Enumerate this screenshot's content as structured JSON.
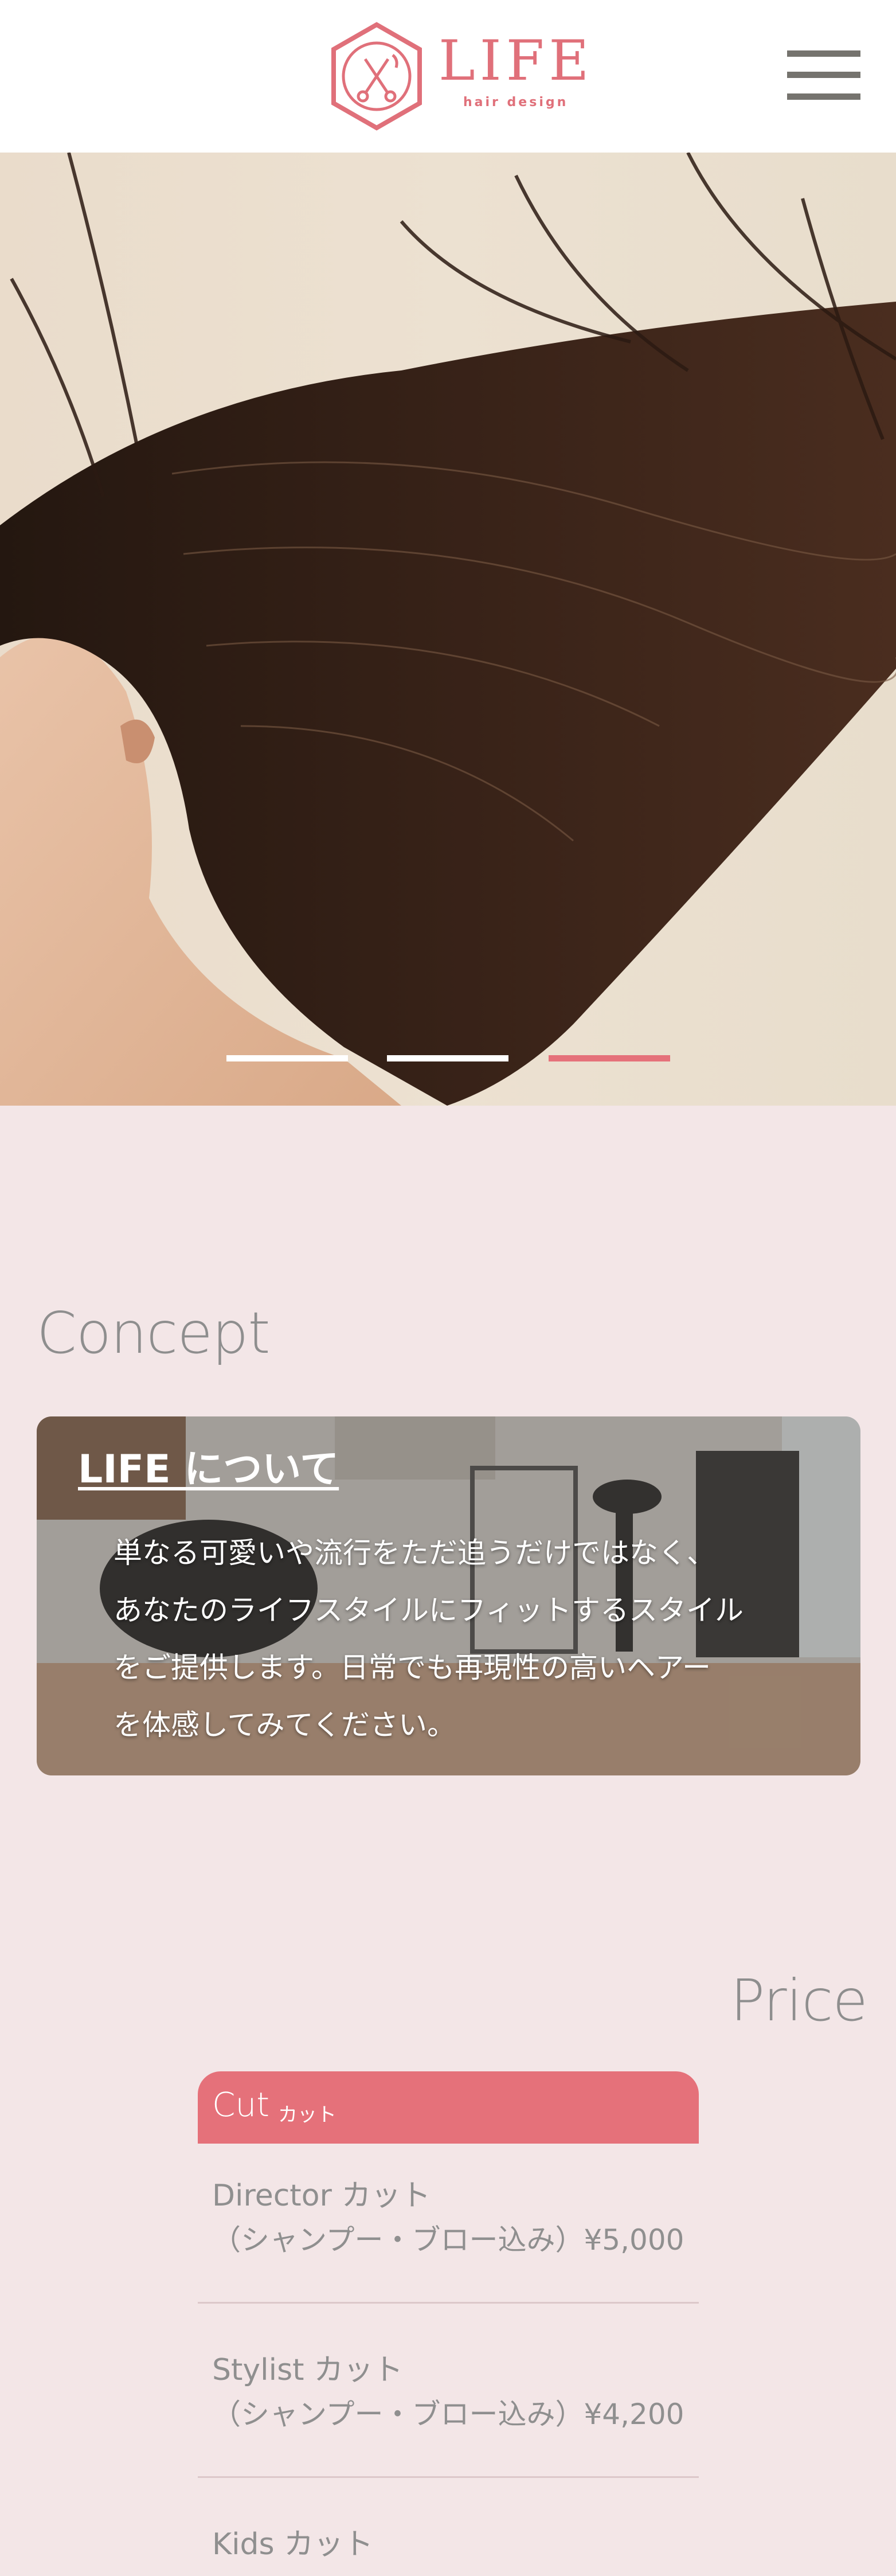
{
  "header": {
    "logo_text": "LIFE",
    "logo_sub": "hair design",
    "menu_label": "menu"
  },
  "hero": {
    "slides": 3,
    "active_slide_index": 2,
    "slider_active_color": "#e5717a",
    "slider_inactive_color": "#ffffff"
  },
  "concept": {
    "title": "Concept",
    "heading": "LIFE について",
    "lines": [
      "単なる可愛いや流行をただ追うだけではなく、",
      "あなたのライフスタイルにフィットするスタイル",
      "をご提供します。日常でも再現性の高いヘアー",
      "を体感してみてください。"
    ]
  },
  "price": {
    "title": "Price",
    "category": {
      "name": "Cut",
      "name_jp": "カット"
    },
    "items": [
      {
        "name": "Director カット",
        "detail": "（シャンプー・ブロー込み）¥5,000"
      },
      {
        "name": "Stylist カット",
        "detail": "（シャンプー・ブロー込み）¥4,200"
      },
      {
        "name": "Kids カット",
        "detail": ""
      }
    ]
  },
  "colors": {
    "brand": "#e0707a",
    "background": "#f3e6e7",
    "text_gray": "#8f8f8f"
  }
}
